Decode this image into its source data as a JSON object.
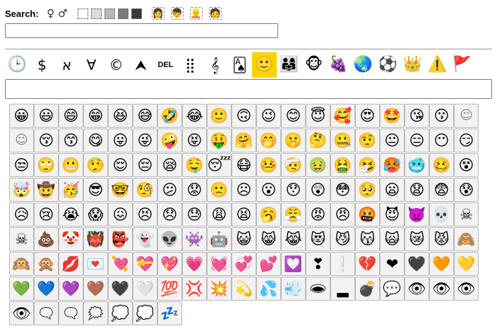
{
  "search": {
    "label": "Search:",
    "value": ""
  },
  "gender_symbols": [
    "♀",
    "♂"
  ],
  "tones": [
    {
      "bg": "#ffffff"
    },
    {
      "bg": "#dcdcdc"
    },
    {
      "bg": "#b8b8b8"
    },
    {
      "bg": "#7a7a7a"
    },
    {
      "bg": "#3a3a3a"
    }
  ],
  "hair_swatches": [
    {
      "glyph": "👩"
    },
    {
      "glyph": "👦"
    },
    {
      "glyph": "👱"
    },
    {
      "glyph": "🧑"
    }
  ],
  "categories": [
    {
      "id": "recent",
      "glyph": "🕒",
      "text": false,
      "active": false
    },
    {
      "id": "currency",
      "glyph": "$",
      "text": true,
      "active": false
    },
    {
      "id": "letterlike",
      "glyph": "א",
      "text": true,
      "active": false
    },
    {
      "id": "math",
      "glyph": "∀",
      "text": true,
      "active": false
    },
    {
      "id": "symbols",
      "glyph": "©",
      "text": true,
      "active": false
    },
    {
      "id": "arrows",
      "glyph": "⮝",
      "text": true,
      "active": false
    },
    {
      "id": "control",
      "glyph": "DEL",
      "text": "del",
      "active": false
    },
    {
      "id": "braille",
      "glyph": "⣿",
      "text": true,
      "active": false
    },
    {
      "id": "music",
      "glyph": "𝄞",
      "text": true,
      "active": false
    },
    {
      "id": "games",
      "glyph": "🂡",
      "text": true,
      "active": false
    },
    {
      "id": "smileys",
      "glyph": "🙂",
      "text": false,
      "active": true
    },
    {
      "id": "people",
      "glyph": "👨‍👩‍👧",
      "text": false,
      "active": false
    },
    {
      "id": "animals",
      "glyph": "🐵",
      "text": false,
      "active": false
    },
    {
      "id": "food",
      "glyph": "🍇",
      "text": false,
      "active": false
    },
    {
      "id": "travel",
      "glyph": "🌏",
      "text": false,
      "active": false
    },
    {
      "id": "activities",
      "glyph": "⚽",
      "text": false,
      "active": false
    },
    {
      "id": "objects",
      "glyph": "👑",
      "text": false,
      "active": false
    },
    {
      "id": "symbols-emoji",
      "glyph": "⚠️",
      "text": false,
      "active": false
    },
    {
      "id": "flags",
      "glyph": "🚩",
      "text": false,
      "active": false
    }
  ],
  "output": {
    "value": ""
  },
  "emojis": [
    "😀",
    "😃",
    "😄",
    "😁",
    "😆",
    "😅",
    "🤣",
    "😂",
    "🙂",
    "🙃",
    "😉",
    "😊",
    "😇",
    "🥰",
    "😍",
    "🤩",
    "😘",
    "😗",
    "☺",
    "☺",
    "😚",
    "😙",
    "😋",
    "😛",
    "😜",
    "🤪",
    "😝",
    "🤑",
    "🤗",
    "🤭",
    "🤫",
    "🤔",
    "🤐",
    "🤨",
    "😐",
    "😑",
    "😶",
    "😏",
    "😒",
    "🙄",
    "😬",
    "🤥",
    "😌",
    "😔",
    "😪",
    "🤤",
    "😴",
    "😷",
    "🤒",
    "🤕",
    "🤢",
    "🤮",
    "🤧",
    "🥵",
    "🥶",
    "🥴",
    "😵",
    "🤯",
    "🤠",
    "🥳",
    "😎",
    "🤓",
    "🧐",
    "😕",
    "😟",
    "🙁",
    "☹",
    "😮",
    "😯",
    "😲",
    "😳",
    "🥺",
    "😦",
    "😧",
    "😨",
    "😰",
    "😥",
    "😢",
    "😭",
    "😱",
    "😖",
    "😣",
    "😞",
    "😓",
    "😩",
    "😫",
    "🥱",
    "😤",
    "😡",
    "😠",
    "🤬",
    "😈",
    "👿",
    "💀",
    "☠",
    "☠",
    "💩",
    "🤡",
    "👹",
    "👺",
    "👻",
    "👽",
    "👾",
    "🤖",
    "😺",
    "😸",
    "😹",
    "😻",
    "😼",
    "😽",
    "🙀",
    "😿",
    "😾",
    "🙈",
    "🙉",
    "🙊",
    "💋",
    "💌",
    "💘",
    "💝",
    "💖",
    "💗",
    "💓",
    "💞",
    "💕",
    "💟",
    "❣",
    "❕",
    "💔",
    "❤",
    "🖤",
    "🧡",
    "💛",
    "💚",
    "💙",
    "💜",
    "🤎",
    "🖤",
    "🤍",
    "💯",
    "💢",
    "💥",
    "💫",
    "💦",
    "💨",
    "🕳",
    "▂",
    "💣",
    "💬",
    "👁",
    "👁",
    "👁",
    "👁",
    "🗨",
    "🗨",
    "🗯",
    "💭",
    "💭",
    "💤"
  ]
}
